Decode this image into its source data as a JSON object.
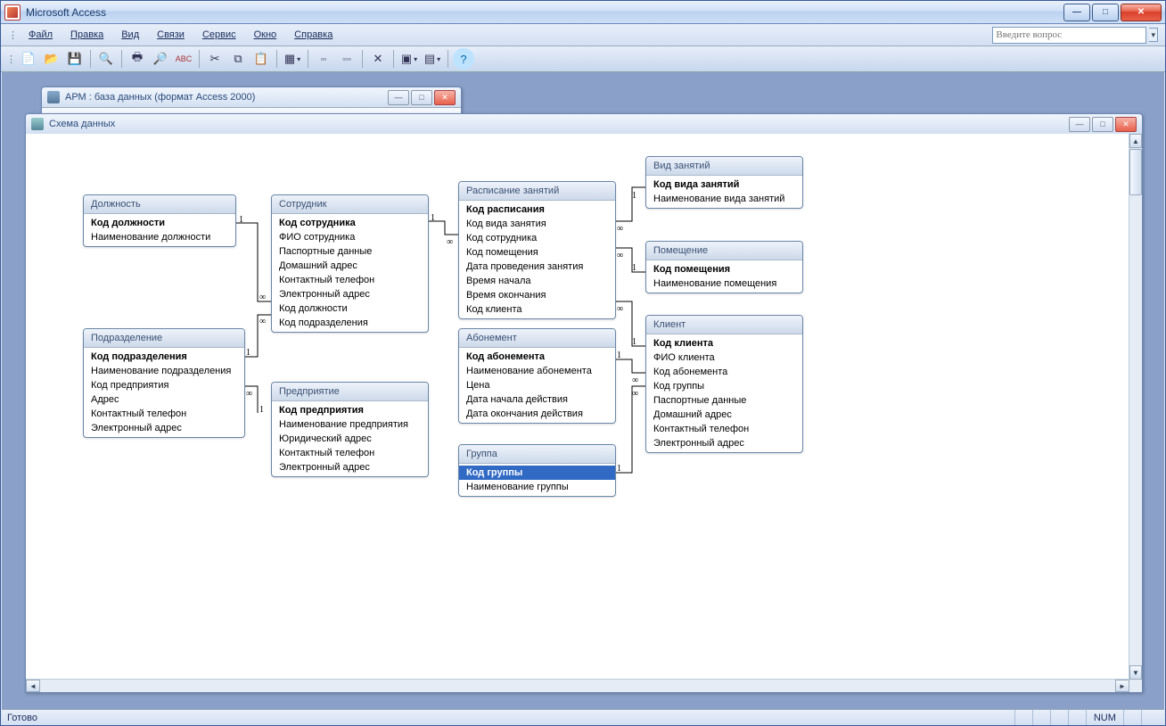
{
  "app": {
    "title": "Microsoft Access"
  },
  "menus": [
    "Файл",
    "Правка",
    "Вид",
    "Связи",
    "Сервис",
    "Окно",
    "Справка"
  ],
  "ask_placeholder": "Введите вопрос",
  "db_window": {
    "title": "АРМ : база данных (формат Access 2000)"
  },
  "schema_window": {
    "title": "Схема данных"
  },
  "tables": {
    "dolzhnost": {
      "title": "Должность",
      "fields": [
        "Код должности",
        "Наименование должности"
      ],
      "pk": [
        0
      ]
    },
    "podrazdelenie": {
      "title": "Подразделение",
      "fields": [
        "Код подразделения",
        "Наименование подразделения",
        "Код предприятия",
        "Адрес",
        "Контактный телефон",
        "Электронный адрес"
      ],
      "pk": [
        0
      ]
    },
    "sotrudnik": {
      "title": "Сотрудник",
      "fields": [
        "Код сотрудника",
        "ФИО сотрудника",
        "Паспортные данные",
        "Домашний адрес",
        "Контактный телефон",
        "Электронный адрес",
        "Код должности",
        "Код подразделения"
      ],
      "pk": [
        0
      ]
    },
    "predpriyatie": {
      "title": "Предприятие",
      "fields": [
        "Код предприятия",
        "Наименование предприятия",
        "Юридический адрес",
        "Контактный телефон",
        "Электронный адрес"
      ],
      "pk": [
        0
      ]
    },
    "raspisanie": {
      "title": "Расписание занятий",
      "fields": [
        "Код расписания",
        "Код вида занятия",
        "Код сотрудника",
        "Код помещения",
        "Дата проведения занятия",
        "Время начала",
        "Время окончания",
        "Код клиента"
      ],
      "pk": [
        0
      ]
    },
    "abonement": {
      "title": "Абонемент",
      "fields": [
        "Код абонемента",
        "Наименование абонемента",
        "Цена",
        "Дата начала действия",
        "Дата окончания действия"
      ],
      "pk": [
        0
      ]
    },
    "gruppa": {
      "title": "Группа",
      "fields": [
        "Код группы",
        "Наименование группы"
      ],
      "pk": [
        0
      ],
      "selected": 0
    },
    "vid": {
      "title": "Вид занятий",
      "fields": [
        "Код вида занятий",
        "Наименование вида занятий"
      ],
      "pk": [
        0
      ]
    },
    "pomeschenie": {
      "title": "Помещение",
      "fields": [
        "Код помещения",
        "Наименование помещения"
      ],
      "pk": [
        0
      ]
    },
    "klient": {
      "title": "Клиент",
      "fields": [
        "Код клиента",
        "ФИО клиента",
        "Код абонемента",
        "Код группы",
        "Паспортные данные",
        "Домашний адрес",
        "Контактный телефон",
        "Электронный адрес"
      ],
      "pk": [
        0
      ]
    }
  },
  "status": {
    "ready": "Готово",
    "num": "NUM"
  },
  "cardinality": {
    "one": "1",
    "many": "∞"
  }
}
